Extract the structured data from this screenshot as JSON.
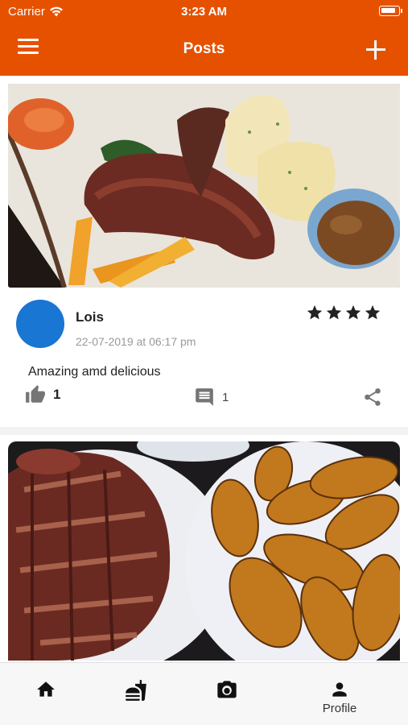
{
  "status": {
    "carrier": "Carrier",
    "time": "3:23 AM"
  },
  "header": {
    "title": "Posts",
    "menu_icon": "menu-icon",
    "add_icon": "plus-icon"
  },
  "posts": [
    {
      "image": "food-photo-lamb-chops-mashed-potatoes",
      "author": "Lois",
      "timestamp": "22-07-2019 at 06:17 pm",
      "rating": 4,
      "caption": "Amazing amd delicious",
      "likes": "1",
      "comments": "1"
    },
    {
      "image": "food-photo-ribs-fried-plantains"
    }
  ],
  "tabbar": {
    "items": [
      {
        "icon": "home-icon",
        "label": ""
      },
      {
        "icon": "food-icon",
        "label": ""
      },
      {
        "icon": "camera-icon",
        "label": ""
      },
      {
        "icon": "person-icon",
        "label": "Profile"
      }
    ]
  },
  "colors": {
    "primary": "#e65100",
    "avatar": "#1976d2"
  }
}
